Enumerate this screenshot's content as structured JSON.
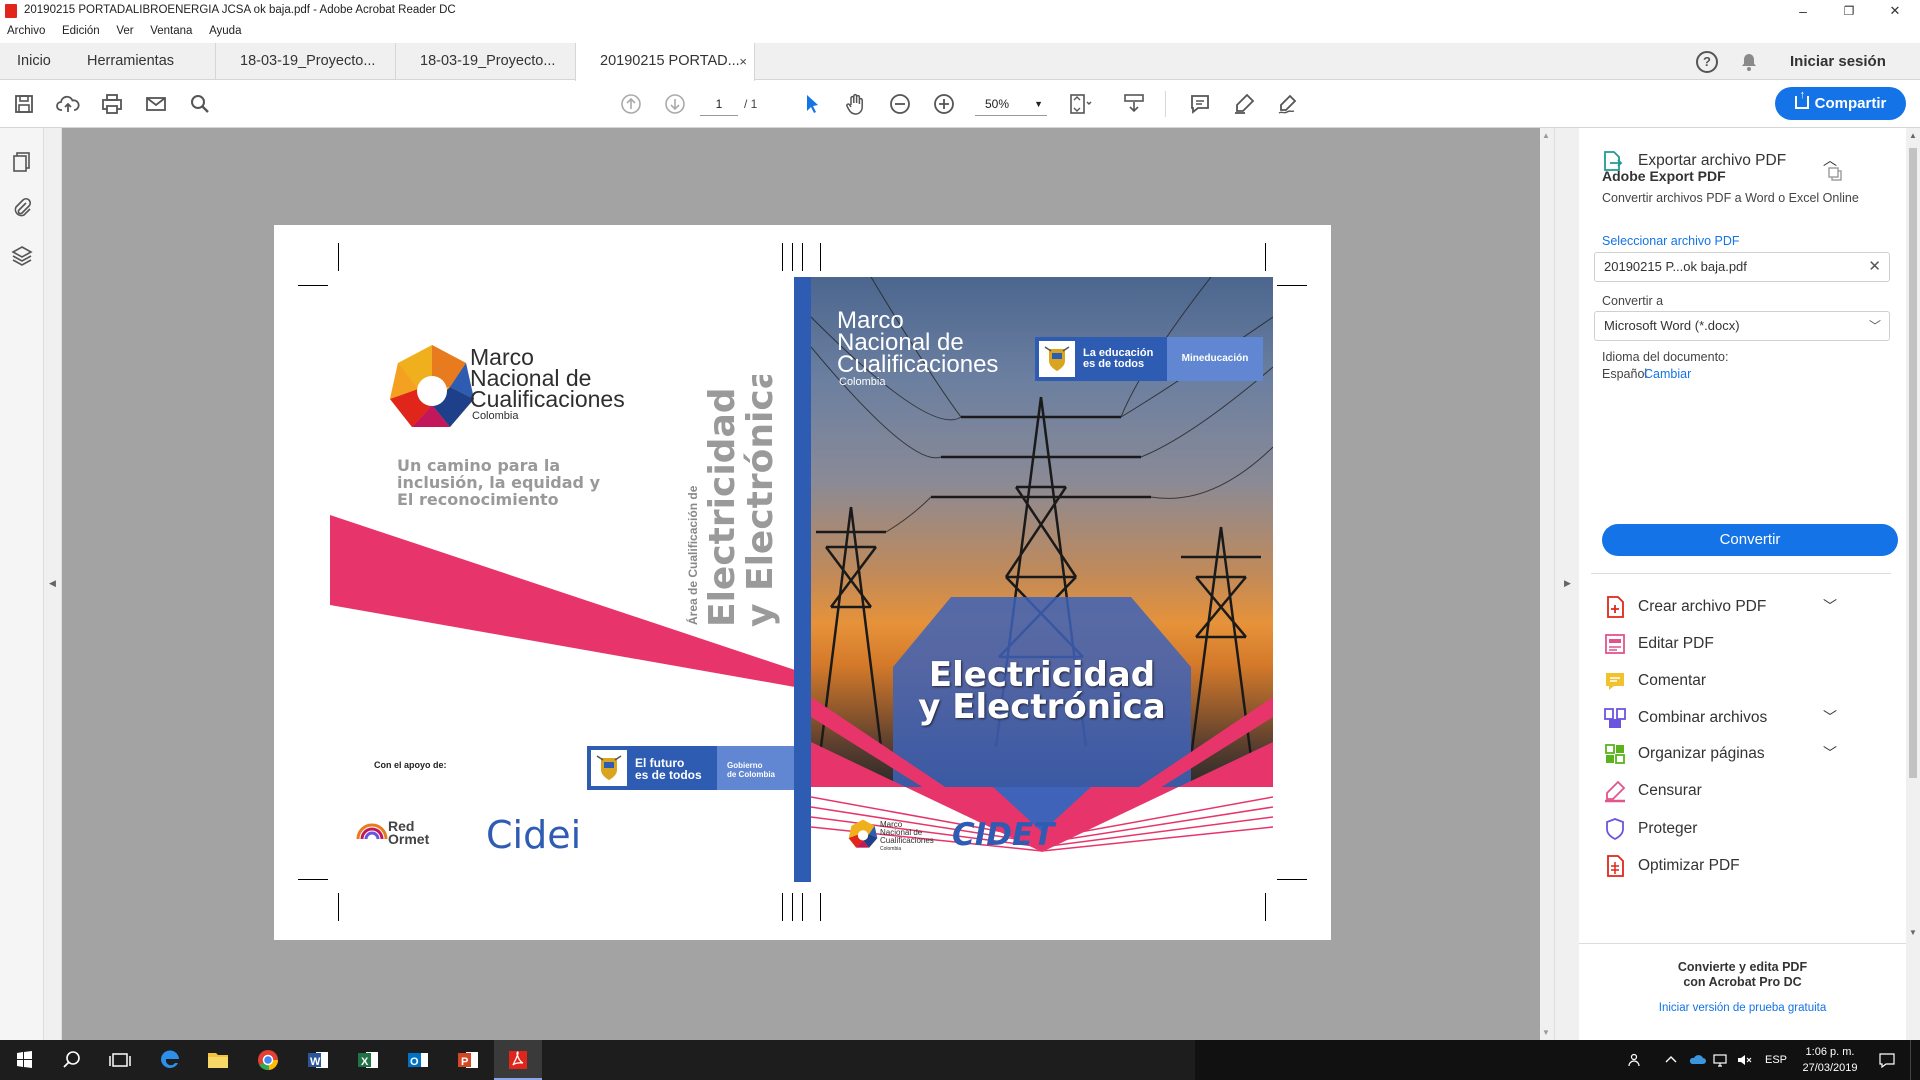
{
  "window": {
    "title": "20190215 PORTADALIBROENERGIA JCSA ok baja.pdf - Adobe Acrobat Reader DC",
    "minimize": "–",
    "maximize": "❐",
    "close": "✕"
  },
  "menu": [
    "Archivo",
    "Edición",
    "Ver",
    "Ventana",
    "Ayuda"
  ],
  "tabs": {
    "home": "Inicio",
    "tools": "Herramientas",
    "docs": [
      {
        "label": "18-03-19_Proyecto..."
      },
      {
        "label": "18-03-19_Proyecto..."
      },
      {
        "label": "20190215 PORTAD...",
        "close": "×"
      }
    ],
    "help": "?",
    "signin": "Iniciar sesión"
  },
  "toolbar": {
    "page_current": "1",
    "page_total": "/ 1",
    "zoom": "50%",
    "share": "Compartir"
  },
  "pdf": {
    "logo": {
      "l1": "Marco",
      "l2": "Nacional de",
      "l3": "Cualificaciones",
      "country": "Colombia"
    },
    "tagline": [
      "Un camino para la",
      "inclusión, la equidad y",
      "El reconocimiento"
    ],
    "spine_small": "Área de Cualificación de",
    "spine_big1": "Electricidad",
    "spine_big2": "y Electrónica",
    "support_label": "Con el apoyo de:",
    "gob_left": [
      "El futuro",
      "es de todos"
    ],
    "gob_right": [
      "Gobierno",
      "de Colombia"
    ],
    "redormet": [
      "Red",
      "Ormet"
    ],
    "cidei": "Cidei",
    "front_logo": {
      "l1": "Marco",
      "l2": "Nacional de",
      "l3": "Cualificaciones",
      "country": "Colombia"
    },
    "mine_left": [
      "La educación",
      "es de todos"
    ],
    "mine_right": "Mineducación",
    "front_title": [
      "Electricidad",
      "y Electrónica"
    ],
    "small_logo": {
      "l1": "Marco",
      "l2": "Nacional de",
      "l3": "Cualificaciones",
      "country": "Colombia"
    },
    "cidet": "CIDET"
  },
  "right_pane": {
    "export_title": "Exportar archivo PDF",
    "service_title": "Adobe Export PDF",
    "service_desc": "Convertir archivos PDF a Word o Excel Online",
    "select_label": "Seleccionar archivo PDF",
    "file_name": "20190215 P...ok baja.pdf",
    "convert_to_label": "Convertir a",
    "convert_to_value": "Microsoft Word (*.docx)",
    "lang_label": "Idioma del documento:",
    "lang_value": "Español",
    "lang_change": "Cambiar",
    "convert_button": "Convertir",
    "tools": [
      {
        "label": "Crear archivo PDF",
        "icon": "create-pdf-icon",
        "color": "#e0261b"
      },
      {
        "label": "Editar PDF",
        "icon": "edit-pdf-icon",
        "color": "#e2548c"
      },
      {
        "label": "Comentar",
        "icon": "comment-icon",
        "color": "#f2c12e"
      },
      {
        "label": "Combinar archivos",
        "icon": "combine-icon",
        "color": "#6a55e0"
      },
      {
        "label": "Organizar páginas",
        "icon": "organize-icon",
        "color": "#5ab31d"
      },
      {
        "label": "Censurar",
        "icon": "redact-icon",
        "color": "#e2548c"
      },
      {
        "label": "Proteger",
        "icon": "protect-icon",
        "color": "#6a55e0"
      },
      {
        "label": "Optimizar PDF",
        "icon": "optimize-icon",
        "color": "#e0261b"
      }
    ],
    "promo": [
      "Convierte y edita PDF",
      "con Acrobat Pro DC"
    ],
    "trial_link": "Iniciar versión de prueba gratuita"
  },
  "taskbar": {
    "lang": "ESP",
    "time": "1:06 p. m.",
    "date": "27/03/2019"
  },
  "colors": {
    "accent": "#1473e6",
    "brand_blue": "#2f5cb3",
    "pink": "#e7356c"
  }
}
